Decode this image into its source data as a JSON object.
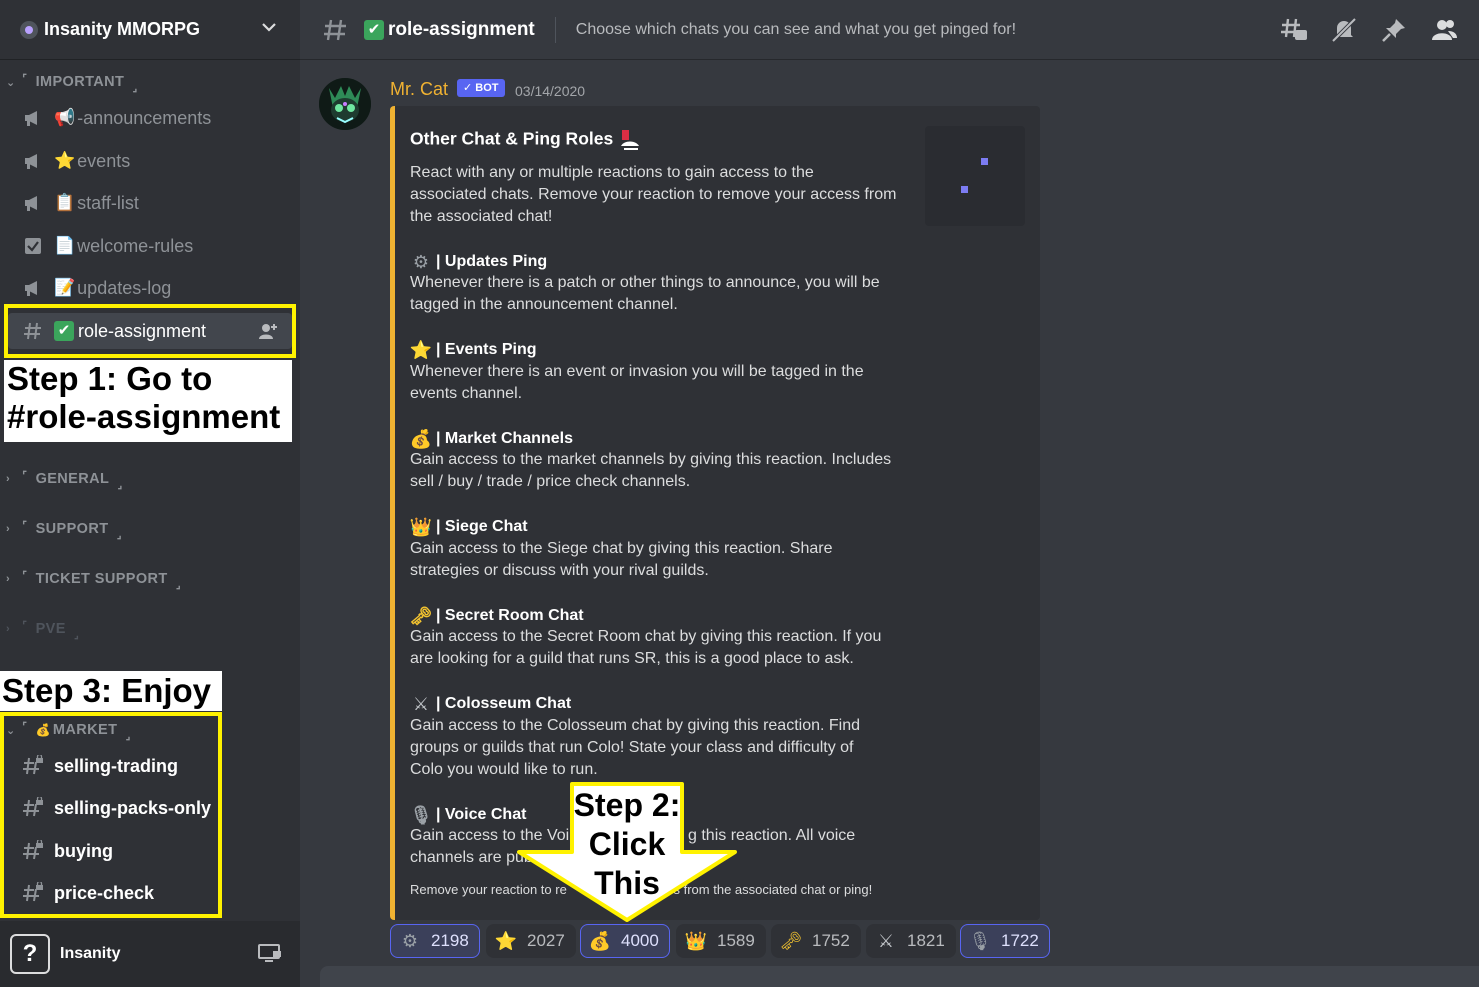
{
  "server": {
    "name": "Insanity MMORPG"
  },
  "sidebar": {
    "categories": [
      {
        "name": "IMPORTANT"
      },
      {
        "name": "GENERAL"
      },
      {
        "name": "SUPPORT"
      },
      {
        "name": "TICKET SUPPORT"
      },
      {
        "name": "PVE"
      },
      {
        "name": "MARKET"
      }
    ],
    "important_channels": [
      {
        "emoji": "📢",
        "name": "-announcements",
        "icon": "announcement-icon"
      },
      {
        "emoji": "⭐",
        "name": "events",
        "icon": "announcement-icon"
      },
      {
        "emoji": "📋",
        "name": "staff-list",
        "icon": "announcement-icon"
      },
      {
        "emoji": "📄",
        "name": "welcome-rules",
        "icon": "rules-icon"
      },
      {
        "emoji": "📝",
        "name": "updates-log",
        "icon": "announcement-icon"
      },
      {
        "emoji": "✔",
        "name": "role-assignment",
        "icon": "hash-icon"
      }
    ],
    "market_channels": [
      {
        "name": "selling-trading"
      },
      {
        "name": "selling-packs-only"
      },
      {
        "name": "buying"
      },
      {
        "name": "price-check"
      }
    ]
  },
  "user": {
    "name": "Insanity",
    "avatar_glyph": "?"
  },
  "header": {
    "channel_name": "role-assignment",
    "check_glyph": "✔",
    "topic": "Choose which chats you can see and what you get pinged for!"
  },
  "message": {
    "author": "Mr. Cat",
    "bot_tag": "✓ BOT",
    "timestamp": "03/14/2020",
    "embed": {
      "title": "Other Chat & Ping Roles",
      "intro_lines": [
        "React with any or multiple reactions to gain access to the",
        "associated chats. Remove your reaction to remove your access from",
        "the associated chat!"
      ],
      "fields": [
        {
          "icon": "⚙",
          "title": "| Updates Ping",
          "lines": [
            "Whenever there is a patch or other things to announce, you will be",
            "tagged in the announcement channel."
          ]
        },
        {
          "icon": "⭐",
          "title": "| Events Ping",
          "lines": [
            "Whenever there is an event or invasion you will be tagged in the",
            "events channel."
          ]
        },
        {
          "icon": "💰",
          "title": "| Market Channels",
          "lines": [
            "Gain access to the market channels by giving this reaction. Includes",
            "sell / buy / trade / price check channels."
          ]
        },
        {
          "icon": "👑",
          "title": "| Siege Chat",
          "lines": [
            "Gain access to the Siege chat by giving this reaction. Share",
            "strategies or discuss with your rival guilds."
          ]
        },
        {
          "icon": "🗝",
          "title": "| Secret Room Chat",
          "lines": [
            "Gain access to the Secret Room chat by giving this reaction. If you",
            "are looking for a guild that runs SR, this is a good place to ask."
          ]
        },
        {
          "icon": "⚔",
          "title": "| Colosseum Chat",
          "lines": [
            "Gain access to the Colosseum chat by giving this reaction. Find",
            "groups or guilds that run Colo! State your class and difficulty of",
            "Colo you would like to run."
          ]
        },
        {
          "icon": "🎙",
          "title": "| Voice Chat",
          "lines": [
            "Gain access to the Voi",
            "channels are pub"
          ],
          "line_right": "g this reaction. All voice"
        }
      ],
      "footer_left": "Remove your reaction to re",
      "footer_right": "ss from the associated chat or ping!"
    }
  },
  "reactions": [
    {
      "icon": "⚙",
      "name": "gear-reaction-icon",
      "count": "2198",
      "me": true
    },
    {
      "icon": "⭐",
      "name": "star-reaction-icon",
      "count": "2027",
      "me": false
    },
    {
      "icon": "💰",
      "name": "moneybag-reaction-icon",
      "count": "4000",
      "me": true
    },
    {
      "icon": "👑",
      "name": "crown-reaction-icon",
      "count": "1589",
      "me": false
    },
    {
      "icon": "🗝",
      "name": "key-reaction-icon",
      "count": "1752",
      "me": false
    },
    {
      "icon": "⚔",
      "name": "swords-reaction-icon",
      "count": "1821",
      "me": false
    },
    {
      "icon": "🎙",
      "name": "microphone-reaction-icon",
      "count": "1722",
      "me": true
    }
  ],
  "annotations": {
    "step1_line1": "Step 1: Go to",
    "step1_line2": "#role-assignment",
    "step2_line1": "Step 2:",
    "step2_line2": "Click",
    "step2_line3": "This",
    "step3": "Step 3: Enjoy",
    "highlight_color": "#fff200"
  },
  "colors": {
    "sidebar_bg": "#2f3136",
    "chat_bg": "#36393f",
    "embed_accent": "#f0b232",
    "author_color": "#f0b232",
    "bot_tag": "#5865f2"
  }
}
